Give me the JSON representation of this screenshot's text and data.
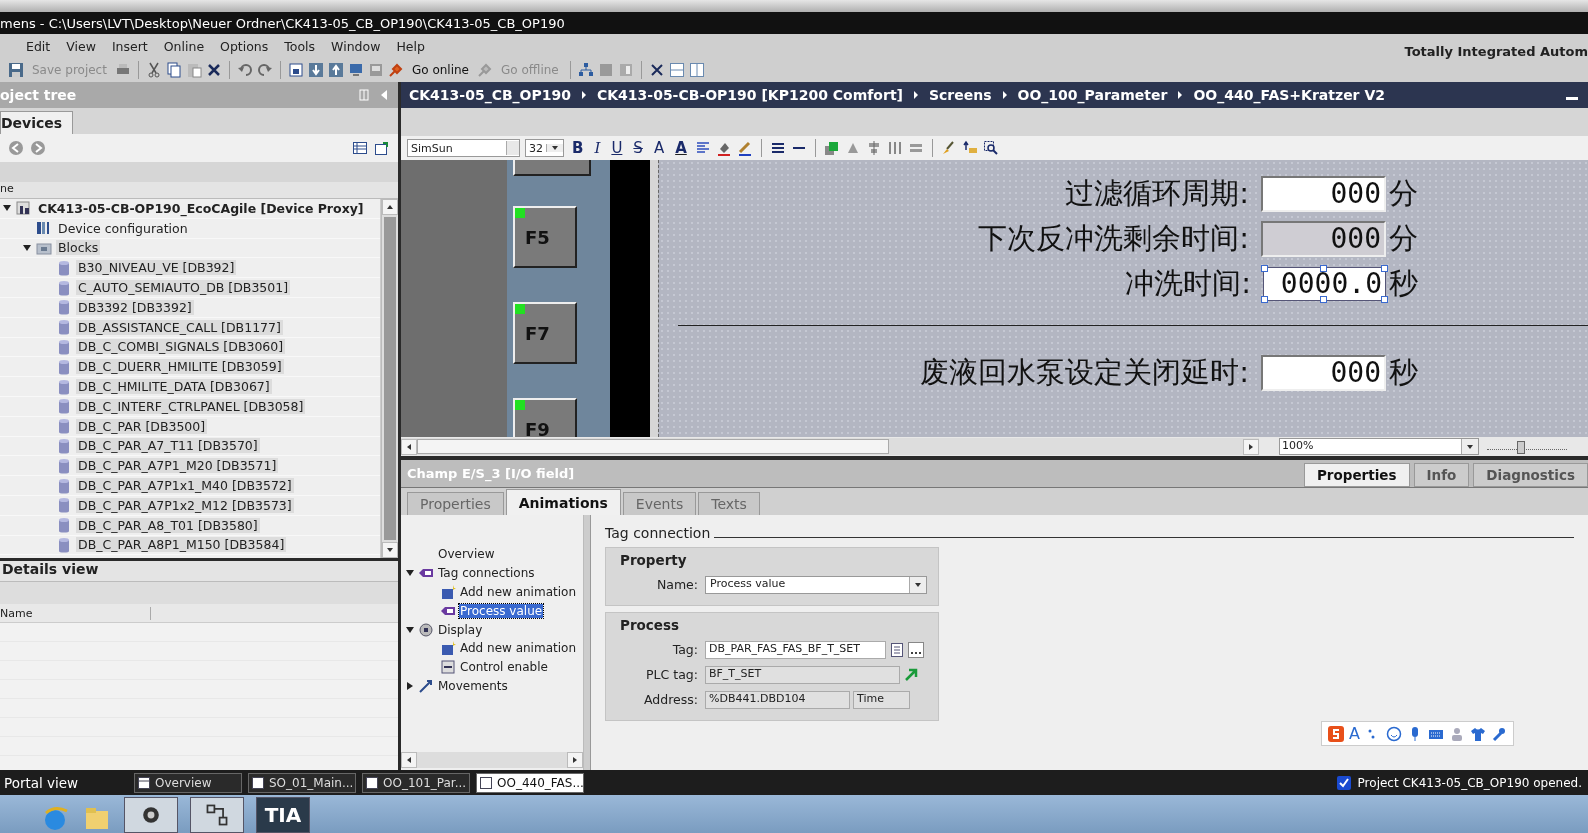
{
  "window": {
    "title": "mens  -  C:\\Users\\LVT\\Desktop\\Neuer Ordner\\CK413-05_CB_OP190\\CK413-05_CB_OP190"
  },
  "menu": {
    "items": [
      "Edit",
      "View",
      "Insert",
      "Online",
      "Options",
      "Tools",
      "Window",
      "Help"
    ],
    "brand": "Totally Integrated Autom"
  },
  "toolbar": {
    "buttons": [
      {
        "label": "Save project",
        "disabled": true
      },
      {
        "label": "Go online",
        "disabled": false
      },
      {
        "label": "Go offline",
        "disabled": true
      }
    ]
  },
  "project_tree": {
    "title": "oject tree",
    "tab": "Devices",
    "column": "ne",
    "items": [
      {
        "label": "CK413-05-CB-OP190_EcoCAgile [Device Proxy]",
        "kind": "device",
        "selected": false,
        "expanded": true,
        "children": [
          {
            "label": "Device configuration",
            "kind": "config",
            "selected": false
          },
          {
            "label": "Blocks",
            "kind": "folder",
            "selected": true,
            "expanded": true,
            "children": [
              {
                "label": "B30_NIVEAU_VE [DB392]",
                "kind": "db",
                "selected": true
              },
              {
                "label": "C_AUTO_SEMIAUTO_DB [DB3501]",
                "kind": "db",
                "selected": true
              },
              {
                "label": "DB3392 [DB3392]",
                "kind": "db",
                "selected": true
              },
              {
                "label": "DB_ASSISTANCE_CALL [DB1177]",
                "kind": "db",
                "selected": true
              },
              {
                "label": "DB_C_COMBI_SIGNALS [DB3060]",
                "kind": "db",
                "selected": true
              },
              {
                "label": "DB_C_DUERR_HMILITE [DB3059]",
                "kind": "db",
                "selected": true
              },
              {
                "label": "DB_C_HMILITE_DATA [DB3067]",
                "kind": "db",
                "selected": true
              },
              {
                "label": "DB_C_INTERF_CTRLPANEL [DB3058]",
                "kind": "db",
                "selected": true
              },
              {
                "label": "DB_C_PAR [DB3500]",
                "kind": "db",
                "selected": true
              },
              {
                "label": "DB_C_PAR_A7_T11 [DB3570]",
                "kind": "db",
                "selected": true
              },
              {
                "label": "DB_C_PAR_A7P1_M20 [DB3571]",
                "kind": "db",
                "selected": true
              },
              {
                "label": "DB_C_PAR_A7P1x1_M40 [DB3572]",
                "kind": "db",
                "selected": true
              },
              {
                "label": "DB_C_PAR_A7P1x2_M12 [DB3573]",
                "kind": "db",
                "selected": true
              },
              {
                "label": "DB_C_PAR_A8_T01 [DB3580]",
                "kind": "db",
                "selected": true
              },
              {
                "label": "DB_C_PAR_A8P1_M150 [DB3584]",
                "kind": "db",
                "selected": true
              }
            ]
          }
        ]
      }
    ]
  },
  "details_view": {
    "title": "Details view",
    "column": "Name"
  },
  "editor": {
    "breadcrumb": [
      "CK413-05_CB_OP190",
      "CK413-05-CB-OP190 [KP1200 Comfort]",
      "Screens",
      "OO_100_Parameter",
      "OO_440_FAS+Kratzer V2"
    ],
    "font": "SimSun",
    "size": "32",
    "format_buttons": [
      {
        "label": "B",
        "kind": "bold"
      },
      {
        "label": "I",
        "kind": "italic"
      },
      {
        "label": "U",
        "kind": "underline"
      },
      {
        "label": "S",
        "kind": "strike"
      },
      {
        "label": "A",
        "kind": "grow"
      },
      {
        "label": "A",
        "kind": "color"
      }
    ],
    "function_keys": [
      "F5",
      "F7",
      "F9"
    ],
    "fields": [
      {
        "label": "过滤循环周期:",
        "value": "000",
        "unit": "分",
        "kind": "input",
        "selected": false
      },
      {
        "label": "下次反冲洗剩余时间:",
        "value": "000",
        "unit": "分",
        "kind": "output",
        "selected": false
      },
      {
        "label": "冲洗时间:",
        "value": "0000.0",
        "unit": "秒",
        "kind": "input",
        "selected": true
      },
      {
        "label": "废液回水泵设定关闭延时:",
        "value": "000",
        "unit": "秒",
        "kind": "input",
        "selected": false
      }
    ],
    "zoom": "100%",
    "zoom_slider": {
      "level": 0.4
    }
  },
  "inspector": {
    "title": "Champ E/S_3 [I/O field]",
    "panel_tabs": [
      {
        "label": "Properties",
        "selected": true
      },
      {
        "label": "Info",
        "selected": false
      },
      {
        "label": "Diagnostics",
        "selected": false
      }
    ],
    "tabs": [
      {
        "label": "Properties",
        "selected": false
      },
      {
        "label": "Animations",
        "selected": true
      },
      {
        "label": "Events",
        "selected": false
      },
      {
        "label": "Texts",
        "selected": false
      }
    ],
    "nav": [
      {
        "label": "Overview",
        "kind": "plain",
        "selected": false
      },
      {
        "label": "Tag connections",
        "kind": "tag",
        "selected": false,
        "expanded": true,
        "children": [
          {
            "label": "Add new animation",
            "kind": "add",
            "selected": false
          },
          {
            "label": "Process value",
            "kind": "tag",
            "selected": true
          }
        ]
      },
      {
        "label": "Display",
        "kind": "display",
        "selected": false,
        "expanded": true,
        "children": [
          {
            "label": "Add new animation",
            "kind": "add",
            "selected": false
          },
          {
            "label": "Control enable",
            "kind": "control",
            "selected": false
          }
        ]
      },
      {
        "label": "Movements",
        "kind": "move",
        "selected": false,
        "expanded": false
      }
    ],
    "section": "Tag connection",
    "property": {
      "title": "Property",
      "name_label": "Name:",
      "name_value": "Process value"
    },
    "process": {
      "title": "Process",
      "tag_label": "Tag:",
      "tag": "DB_PAR_FAS_FAS_BF_T_SET",
      "plc_label": "PLC tag:",
      "plc_tag": "BF_T_SET",
      "address_label": "Address:",
      "address": "%DB441.DBD104",
      "type": "Time"
    },
    "ime": "A"
  },
  "status_bar": {
    "portal": "Portal view",
    "editors": [
      {
        "label": "Overview",
        "selected": false
      },
      {
        "label": "SO_01_Main...",
        "selected": false
      },
      {
        "label": "OO_101_Par...",
        "selected": false
      },
      {
        "label": "OO_440_FAS...",
        "selected": true
      }
    ],
    "message": "Project CK413-05_CB_OP190 opened."
  },
  "taskbar": {
    "app_label": "TIA"
  }
}
